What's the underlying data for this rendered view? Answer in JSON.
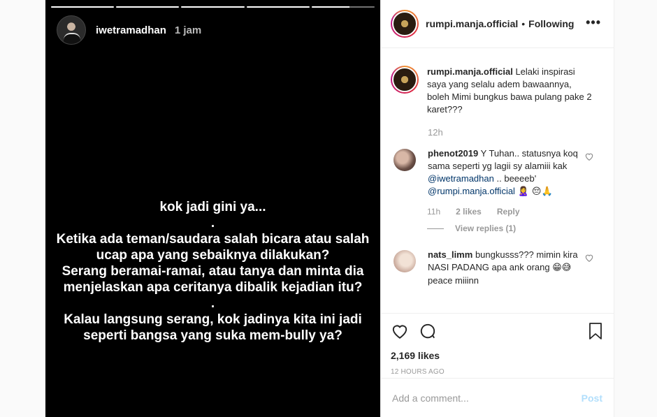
{
  "story": {
    "progress": [
      1,
      1,
      1,
      1,
      0.6
    ],
    "username": "iwetramadhan",
    "time": "1 jam",
    "lines": [
      "kok jadi gini ya...",
      ".",
      "Ketika ada teman/saudara salah bicara atau salah",
      "ucap apa yang sebaiknya dilakukan?",
      "Serang beramai-ramai, atau tanya dan minta dia",
      "menjelaskan apa ceritanya dibalik kejadian itu?",
      ".",
      "Kalau langsung serang, kok jadinya kita ini jadi",
      "seperti bangsa yang suka mem-bully ya?"
    ]
  },
  "panel": {
    "header": {
      "username": "rumpi.manja.official",
      "separator": "•",
      "follow_status": "Following",
      "more_icon": "more-options-icon"
    },
    "caption": {
      "username": "rumpi.manja.official",
      "text": "Lelaki inspirasi saya yang selalu adem bawaannya, boleh Mimi bungkus bawa pulang pake 2 karet???",
      "time": "12h"
    },
    "comments": [
      {
        "username": "phenot2019",
        "text_1": "Y Tuhan.. statusnya koq sama seperti yg lagii sy alamiii kak",
        "mention_1": "@iwetramadhan",
        "text_2": "..",
        "text_3": "beeeeb'",
        "mention_2": "@rumpi.manja.official",
        "emojis": "🙎‍♀️ 😔🙏",
        "time": "11h",
        "likes": "2 likes",
        "reply": "Reply",
        "view_replies": "View replies (1)"
      },
      {
        "username": "nats_limm",
        "text": "bungkusss??? mimin kira NASI PADANG apa ank orang",
        "emojis": "😁😅",
        "text_after": "peace miiinn"
      }
    ],
    "likes": "2,169 likes",
    "timestamp": "12 HOURS AGO",
    "comment_input": {
      "placeholder": "Add a comment..."
    },
    "post_label": "Post"
  }
}
